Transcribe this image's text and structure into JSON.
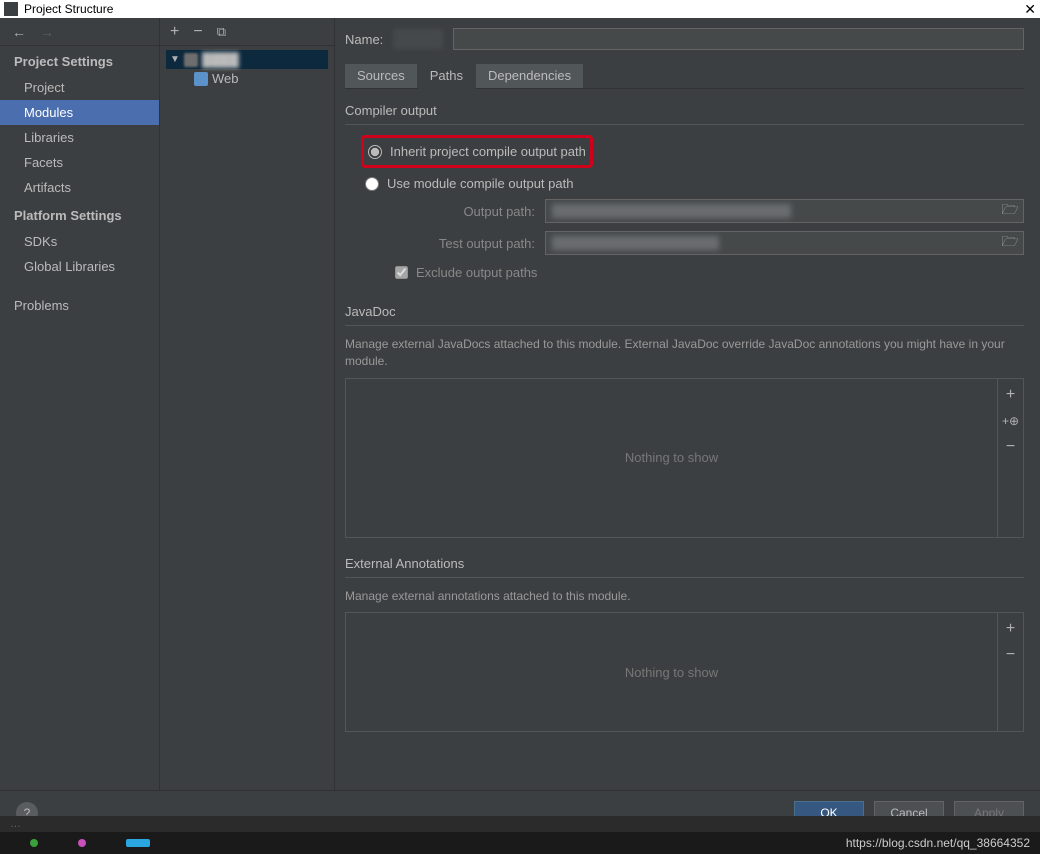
{
  "window": {
    "title": "Project Structure",
    "close": "✕"
  },
  "nav": {
    "projectSettingsHeader": "Project Settings",
    "items": {
      "project": "Project",
      "modules": "Modules",
      "libraries": "Libraries",
      "facets": "Facets",
      "artifacts": "Artifacts"
    },
    "platformSettingsHeader": "Platform Settings",
    "platformItems": {
      "sdks": "SDKs",
      "globalLibraries": "Global Libraries"
    },
    "problems": "Problems"
  },
  "tree": {
    "webLabel": "Web"
  },
  "content": {
    "nameLabel": "Name:",
    "tabs": {
      "sources": "Sources",
      "paths": "Paths",
      "dependencies": "Dependencies"
    },
    "compilerOutput": {
      "title": "Compiler output",
      "inheritRadio": "Inherit project compile output path",
      "moduleRadio": "Use module compile output path",
      "outputPathLabel": "Output path:",
      "testOutputPathLabel": "Test output path:",
      "excludeCheck": "Exclude output paths"
    },
    "javadoc": {
      "title": "JavaDoc",
      "desc": "Manage external JavaDocs attached to this module. External JavaDoc override JavaDoc annotations you might have in your module.",
      "empty": "Nothing to show"
    },
    "extAnnotations": {
      "title": "External Annotations",
      "desc": "Manage external annotations attached to this module.",
      "empty": "Nothing to show"
    }
  },
  "footer": {
    "ok": "OK",
    "cancel": "Cancel",
    "apply": "Apply",
    "help": "?"
  },
  "watermark": "https://blog.csdn.net/qq_38664352"
}
